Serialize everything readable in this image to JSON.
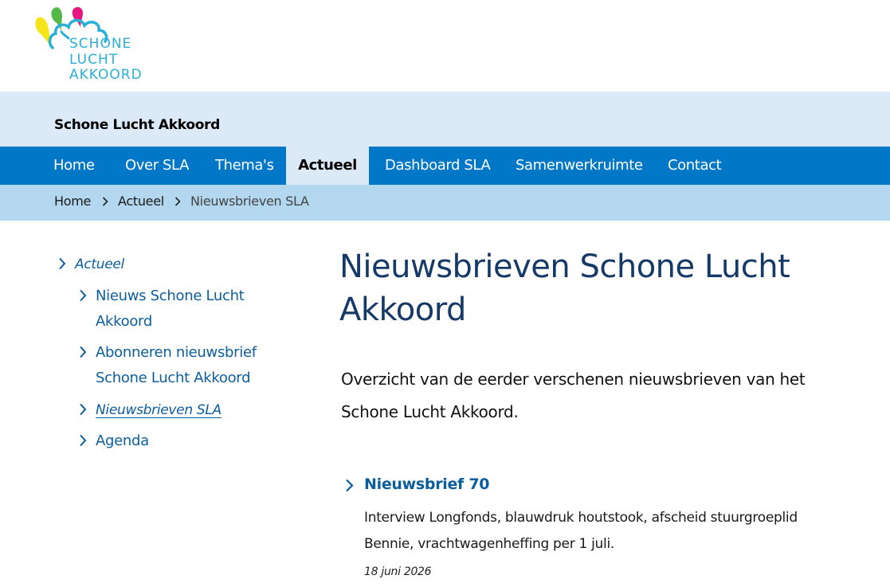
{
  "logo": {
    "lines": [
      "SCHONE",
      "LUCHT",
      "AKKOORD"
    ]
  },
  "site": {
    "title": "Schone Lucht Akkoord"
  },
  "nav": {
    "items": [
      {
        "label": "Home"
      },
      {
        "label": "Over SLA"
      },
      {
        "label": "Thema's"
      },
      {
        "label": "Actueel",
        "active": true
      },
      {
        "label": "Dashboard SLA"
      },
      {
        "label": "Samenwerkruimte"
      },
      {
        "label": "Contact"
      }
    ]
  },
  "breadcrumb": {
    "items": [
      "Home",
      "Actueel",
      "Nieuwsbrieven SLA"
    ]
  },
  "sidebar": {
    "parent": "Actueel",
    "items": [
      {
        "line1": "Nieuws Schone Lucht",
        "line2": "Akkoord"
      },
      {
        "line1": "Abonneren nieuwsbrief",
        "line2": "Schone Lucht Akkoord"
      },
      {
        "line1": "Nieuwsbrieven SLA",
        "current": true
      },
      {
        "line1": "Agenda"
      }
    ]
  },
  "main": {
    "title_line1": "Nieuwsbrieven Schone Lucht",
    "title_line2": "Akkoord",
    "intro_line1": "Overzicht van de eerder verschenen nieuwsbrieven van het",
    "intro_line2": "Schone Lucht Akkoord.",
    "news": [
      {
        "title": "Nieuwsbrief 70",
        "desc_line1": "Interview Longfonds, blauwdruk houtstook, afscheid stuurgroeplid",
        "desc_line2": "Bennie,  vrachtwagenheffing per 1 juli.",
        "date": "18 juni 2026"
      }
    ]
  },
  "colors": {
    "nav_bg": "#0177c7",
    "band_bg": "#dce9f7",
    "crumb_bg": "#b2d7ef",
    "link": "#0c5d9c",
    "heading": "#163a68",
    "logo_text": "#2ab0d6"
  },
  "icons": [
    "chevron-right-icon",
    "logo-balloons"
  ]
}
